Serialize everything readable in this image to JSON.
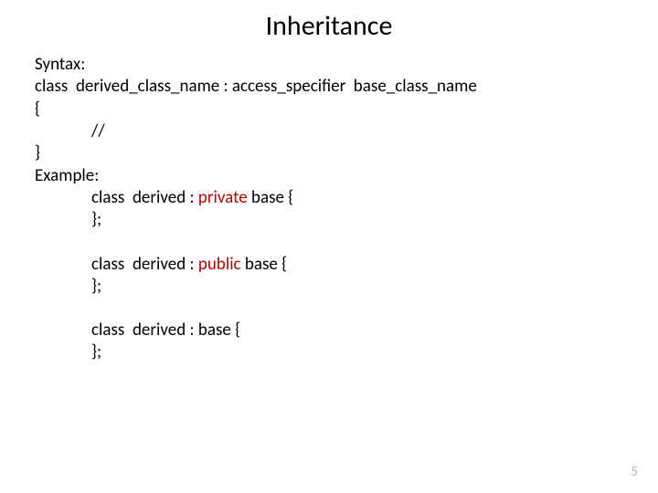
{
  "title": "Inheritance",
  "syntax_label": "Syntax:",
  "syntax_line": "class  derived_class_name : access_specifier  base_class_name",
  "brace_open": "{",
  "comment_line": "//",
  "brace_close": "}",
  "example_label": "Example:",
  "ex1_a": "class  derived : ",
  "ex1_kw": "private",
  "ex1_b": " base {",
  "ex1_close": "};",
  "ex2_a": "class  derived : ",
  "ex2_kw": "public",
  "ex2_b": " base {",
  "ex2_close": "};",
  "ex3_a": "class  derived : base {",
  "ex3_close": "};",
  "page_number": "5"
}
